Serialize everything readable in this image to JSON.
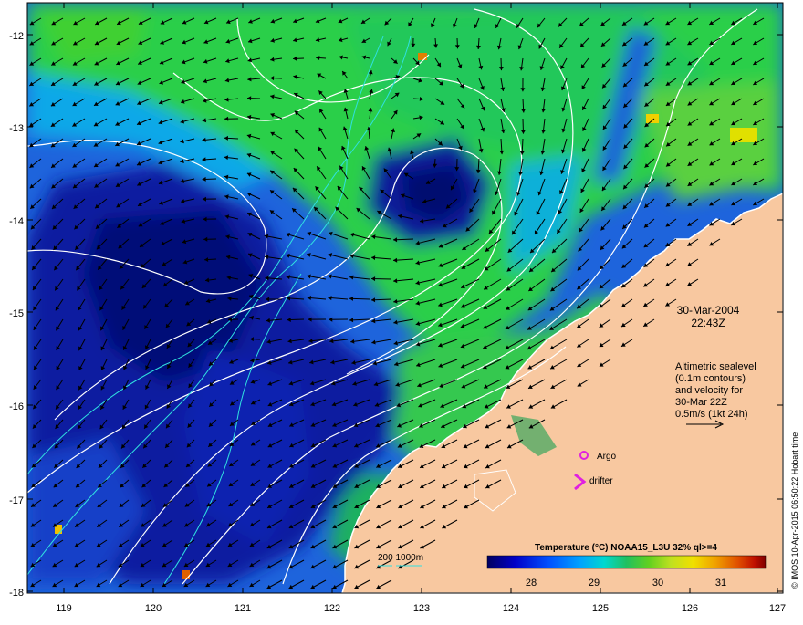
{
  "map": {
    "date_line1": "30-Mar-2004",
    "date_line2": "22:43Z",
    "info_lines": [
      "Altimetric sealevel",
      "(0.1m contours)",
      "and velocity for",
      "30-Mar 22Z",
      "0.5m/s (1kt 24h)"
    ],
    "lon_ticks": [
      "119",
      "120",
      "121",
      "122",
      "123",
      "124",
      "125",
      "126",
      "127"
    ],
    "lat_ticks": [
      "-12",
      "-13",
      "-14",
      "-15",
      "-16",
      "-17",
      "-18"
    ],
    "legend": {
      "argo_label": "Argo",
      "drifter_label": "drifter",
      "argo_color": "#e020e0",
      "drifter_color": "#e020e0"
    },
    "depth_legend_label": "200  1000m",
    "colorbar": {
      "title": "Temperature (°C) NOAA15_L3U 32% ql>=4",
      "ticks": [
        "28",
        "29",
        "30",
        "31"
      ],
      "colors": [
        "#000060",
        "#0000c8",
        "#0050ff",
        "#00a0ff",
        "#00d8d0",
        "#20c060",
        "#60d020",
        "#c0e020",
        "#f0e000",
        "#f0a000",
        "#e05000",
        "#c01000",
        "#800000"
      ]
    },
    "credit": "© IMOS 10-Apr-2015 06:50:22 Hobart time",
    "land_color": "#f8c8a0",
    "ocean_deep_color": "#0a1e8c",
    "ocean_warm_color": "#2ecc40"
  }
}
